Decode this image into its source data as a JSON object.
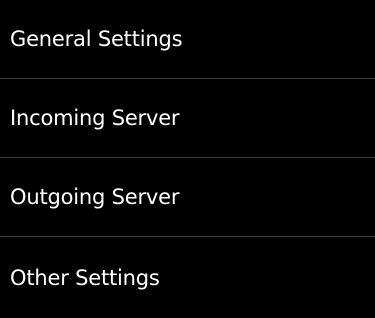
{
  "menu": {
    "items": [
      {
        "label": "General Settings"
      },
      {
        "label": "Incoming Server"
      },
      {
        "label": "Outgoing Server"
      },
      {
        "label": "Other Settings"
      }
    ]
  },
  "colors": {
    "background": "#000000",
    "text": "#ffffff",
    "divider": "#3a3a3a"
  }
}
